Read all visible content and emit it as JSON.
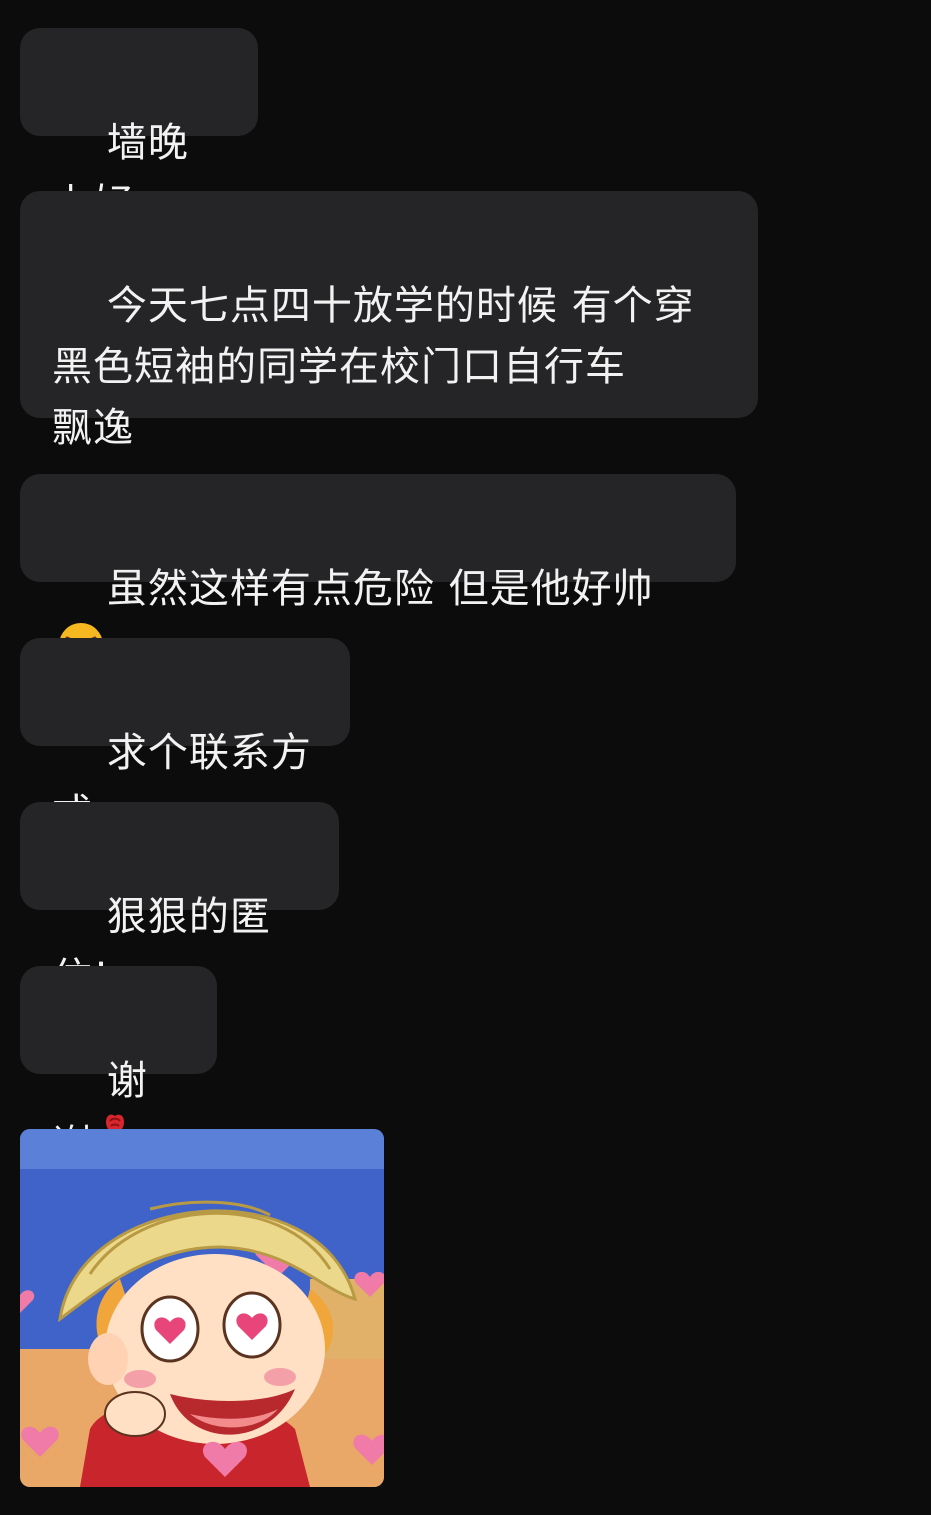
{
  "messages": [
    {
      "text": "墙晚上好"
    },
    {
      "text": "今天七点四十放学的时候 有个穿\n黑色短袖的同学在校门口自行车\n飘逸"
    },
    {
      "text": "虽然这样有点危险 但是他好帅",
      "emoji": "screaming-face-emoji"
    },
    {
      "text": "求个联系方式"
    },
    {
      "text": "狠狠的匿住!"
    },
    {
      "text": "谢谢",
      "emoji": "rose-emoji"
    }
  ],
  "sticker": {
    "icon": "cartoon-girl-heart-eyes-sticker",
    "colors": {
      "background": "#3f63c8",
      "hat": "#ecd88a",
      "shirt": "#c8262c",
      "heart": "#f07aa8"
    }
  },
  "colors": {
    "background": "#0c0c0d",
    "bubble": "#252527",
    "text": "#f2f2f2"
  }
}
